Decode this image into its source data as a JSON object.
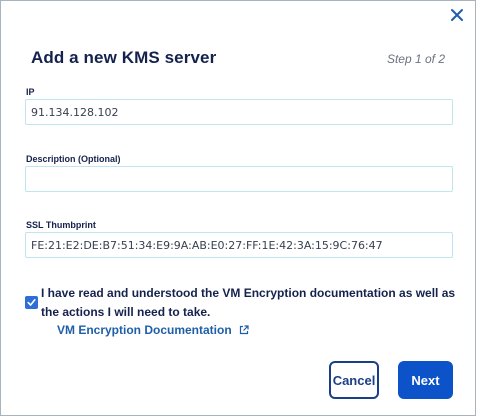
{
  "dialog": {
    "title": "Add a new KMS server",
    "step": "Step 1 of 2",
    "close_icon": "close-icon"
  },
  "fields": {
    "ip": {
      "label": "IP",
      "value": "91.134.128.102"
    },
    "description": {
      "label": "Description (Optional)",
      "value": ""
    },
    "ssl_thumbprint": {
      "label": "SSL Thumbprint",
      "value": "FE:21:E2:DE:B7:51:34:E9:9A:AB:E0:27:FF:1E:42:3A:15:9C:76:47"
    }
  },
  "agreement": {
    "checked": true,
    "text": "I have read and understood the VM Encryption documentation as well as the actions I will need to take.",
    "link_text": "VM Encryption Documentation",
    "link_icon": "external-link-icon"
  },
  "actions": {
    "cancel_label": "Cancel",
    "next_label": "Next"
  },
  "colors": {
    "title": "#14224d",
    "link": "#1e5fa8",
    "primary": "#0c52c8",
    "secondary_border": "#1b3f86",
    "input_border": "#bfe6ee",
    "checkbox": "#2d6fd7"
  }
}
